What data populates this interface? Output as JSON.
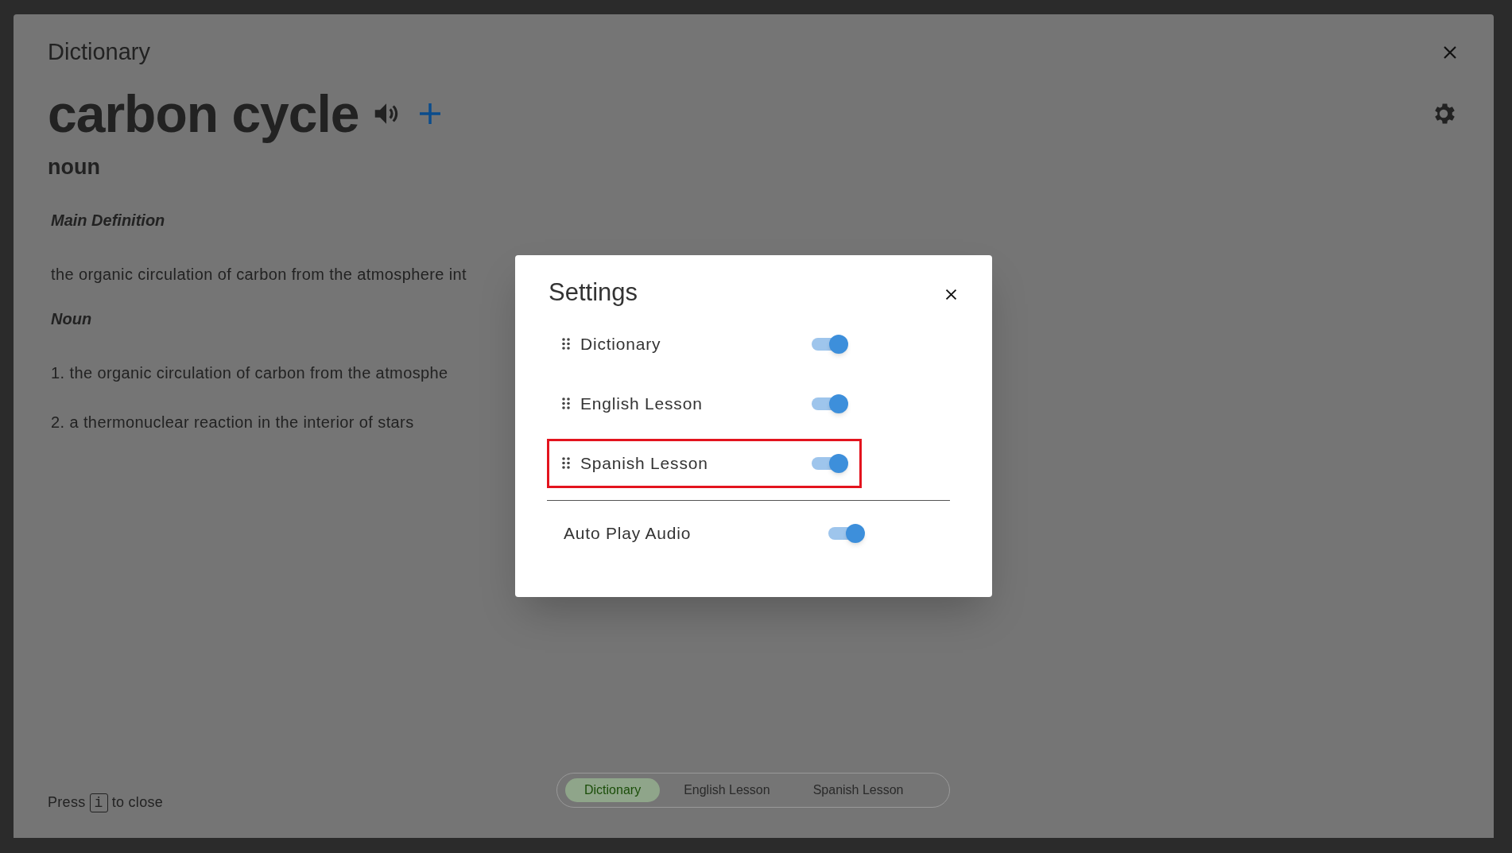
{
  "panel": {
    "title": "Dictionary",
    "word": "carbon cycle",
    "part_of_speech": "noun"
  },
  "sections": [
    {
      "heading": "Main Definition",
      "lines": [
        "the organic circulation of carbon from the atmosphere int"
      ]
    },
    {
      "heading": "Noun",
      "lines": [
        "1. the organic circulation of carbon from the atmosphe",
        "2. a thermonuclear reaction in the interior of stars"
      ]
    }
  ],
  "footer": {
    "before": "Press",
    "key": "i",
    "after": "to close"
  },
  "tabs": [
    {
      "label": "Dictionary",
      "selected": true
    },
    {
      "label": "English Lesson",
      "selected": false
    },
    {
      "label": "Spanish Lesson",
      "selected": false
    }
  ],
  "settings": {
    "title": "Settings",
    "sources": [
      {
        "label": "Dictionary",
        "on": true,
        "highlighted": false
      },
      {
        "label": "English Lesson",
        "on": true,
        "highlighted": false
      },
      {
        "label": "Spanish Lesson",
        "on": true,
        "highlighted": true
      }
    ],
    "options": [
      {
        "label": "Auto Play Audio",
        "on": true
      }
    ]
  }
}
